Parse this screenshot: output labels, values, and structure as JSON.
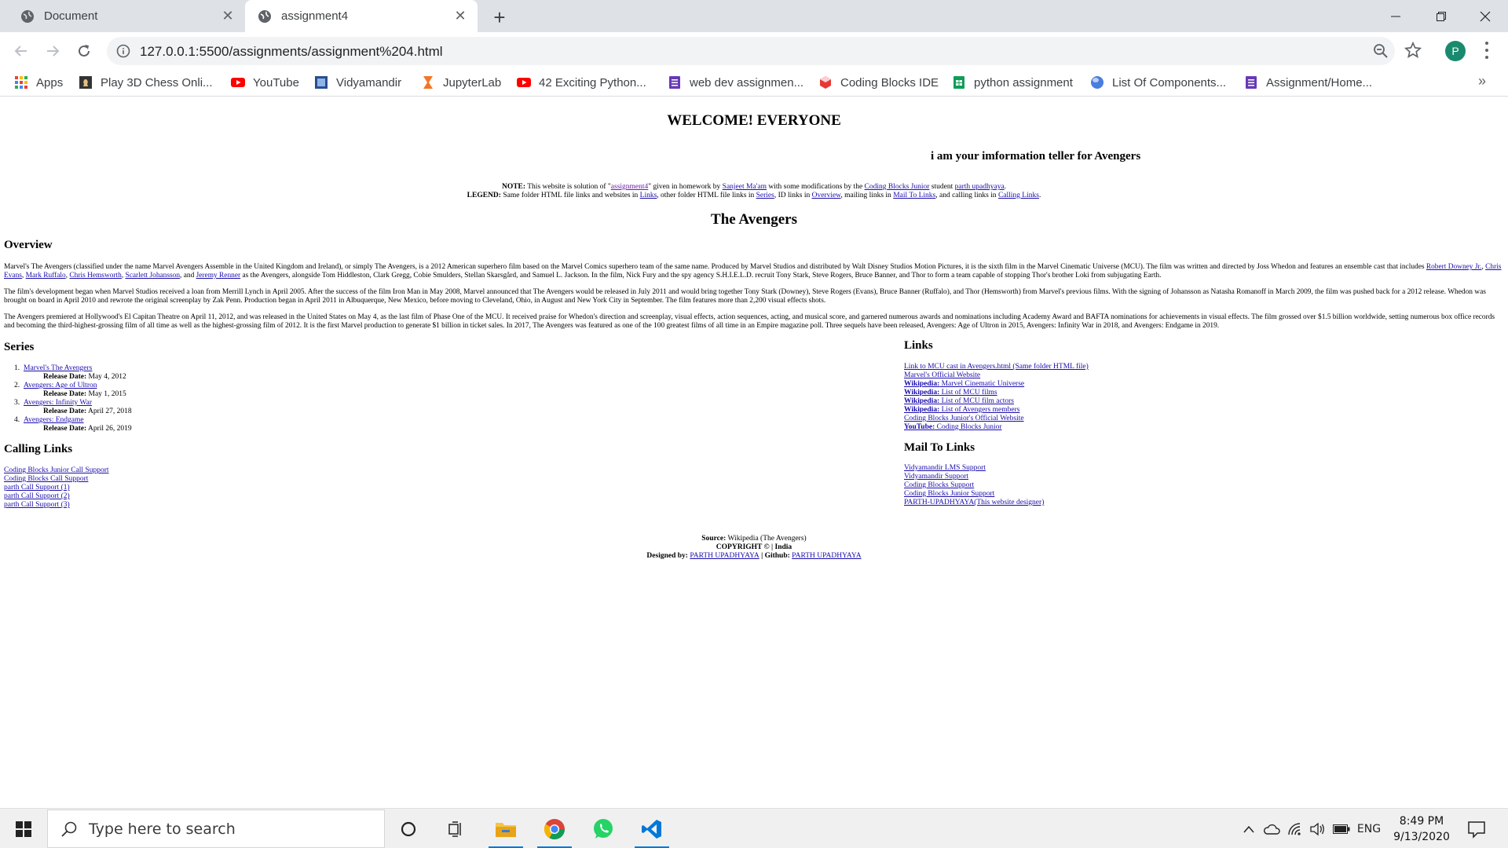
{
  "browser": {
    "tabs": [
      {
        "title": "Document",
        "active": false
      },
      {
        "title": "assignment4",
        "active": true
      }
    ],
    "url": "127.0.0.1:5500/assignments/assignment%204.html",
    "profile_initial": "P",
    "bookmarks": [
      {
        "label": "Apps",
        "icon": "apps-grid-icon"
      },
      {
        "label": "Play 3D Chess Onli...",
        "icon": "chess-icon"
      },
      {
        "label": "YouTube",
        "icon": "youtube-icon"
      },
      {
        "label": "Vidyamandir",
        "icon": "vidyamandir-icon"
      },
      {
        "label": "JupyterLab",
        "icon": "jupyter-icon"
      },
      {
        "label": "42 Exciting Python...",
        "icon": "youtube-icon"
      },
      {
        "label": "web dev assignmen...",
        "icon": "forms-icon"
      },
      {
        "label": "Coding Blocks IDE",
        "icon": "coding-blocks-icon"
      },
      {
        "label": "python assignment",
        "icon": "sheets-icon"
      },
      {
        "label": "List Of Components...",
        "icon": "globe-icon"
      },
      {
        "label": "Assignment/Home...",
        "icon": "forms-icon"
      }
    ],
    "bookmarks_more": "»"
  },
  "page": {
    "welcome": "WELCOME! EVERYONE",
    "teller": "i am your imformation teller for Avengers",
    "note": {
      "label": "NOTE:",
      "t1": " This website is solution of \"",
      "link1": "assignment4",
      "t2": "\" given in homework by ",
      "link2": "Sanjeet Ma'am",
      "t3": " with some modifications by the ",
      "link3": "Coding Blocks Junior",
      "t4": " student ",
      "link4": "parth upadhyaya",
      "t5": "."
    },
    "legend": {
      "label": "LEGEND:",
      "t1": " Same folder HTML file links and websites in ",
      "link1": "Links",
      "t2": ", other folder HTML file links in ",
      "link2": "Series",
      "t3": ", ID links in ",
      "link3": "Overview",
      "t4": ", mailing links in ",
      "link4": "Mail To Links",
      "t5": ", and calling links in ",
      "link5": "Calling Links",
      "t6": "."
    },
    "title": "The Avengers",
    "overview_heading": "Overview",
    "p1": {
      "t1": "Marvel's The Avengers (classified under the name Marvel Avengers Assemble in the United Kingdom and Ireland), or simply The Avengers, is a 2012 American superhero film based on the Marvel Comics superhero team of the same name. Produced by Marvel Studios and distributed by Walt Disney Studios Motion Pictures, it is the sixth film in the Marvel Cinematic Universe (MCU). The film was written and directed by Joss Whedon and features an ensemble cast that includes ",
      "a1": "Robert Downey Jr.",
      "s1": ", ",
      "a2": "Chris Evans",
      "s2": ", ",
      "a3": "Mark Ruffalo",
      "s3": ", ",
      "a4": "Chris Hemsworth",
      "s4": ", ",
      "a5": "Scarlett Johansson",
      "s5": ", and ",
      "a6": "Jeremy Renner",
      "t2": " as the Avengers, alongside Tom Hiddleston, Clark Gregg, Cobie Smulders, Stellan Skarsgård, and Samuel L. Jackson. In the film, Nick Fury and the spy agency S.H.I.E.L.D. recruit Tony Stark, Steve Rogers, Bruce Banner, and Thor to form a team capable of stopping Thor's brother Loki from subjugating Earth."
    },
    "p2": "The film's development began when Marvel Studios received a loan from Merrill Lynch in April 2005. After the success of the film Iron Man in May 2008, Marvel announced that The Avengers would be released in July 2011 and would bring together Tony Stark (Downey), Steve Rogers (Evans), Bruce Banner (Ruffalo), and Thor (Hemsworth) from Marvel's previous films. With the signing of Johansson as Natasha Romanoff in March 2009, the film was pushed back for a 2012 release. Whedon was brought on board in April 2010 and rewrote the original screenplay by Zak Penn. Production began in April 2011 in Albuquerque, New Mexico, before moving to Cleveland, Ohio, in August and New York City in September. The film features more than 2,200 visual effects shots.",
    "p3": "The Avengers premiered at Hollywood's El Capitan Theatre on April 11, 2012, and was released in the United States on May 4, as the last film of Phase One of the MCU. It received praise for Whedon's direction and screenplay, visual effects, action sequences, acting, and musical score, and garnered numerous awards and nominations including Academy Award and BAFTA nominations for achievements in visual effects. The film grossed over $1.5 billion worldwide, setting numerous box office records and becoming the third-highest-grossing film of all time as well as the highest-grossing film of 2012. It is the first Marvel production to generate $1 billion in ticket sales. In 2017, The Avengers was featured as one of the 100 greatest films of all time in an Empire magazine poll. Three sequels have been released, Avengers: Age of Ultron in 2015, Avengers: Infinity War in 2018, and Avengers: Endgame in 2019.",
    "series_heading": "Series",
    "release_label": "Release Date:",
    "series": [
      {
        "num": "1.",
        "title": "Marvel's The Avengers",
        "date": " May 4, 2012"
      },
      {
        "num": "2.",
        "title": "Avengers: Age of Ultron",
        "date": " May 1, 2015"
      },
      {
        "num": "3.",
        "title": "Avengers: Infinity War",
        "date": " April 27, 2018"
      },
      {
        "num": "4.",
        "title": "Avengers: Endgame",
        "date": " April 26, 2019"
      }
    ],
    "calling_heading": "Calling Links",
    "calling": [
      "Coding Blocks Junior Call Support",
      "Coding Blocks Call Support",
      "parth Call Support (1)",
      "parth Call Support (2)",
      "parth Call Support (3)"
    ],
    "links_heading": "Links",
    "links": [
      {
        "bold": "",
        "text": "Link to MCU cast in Avengers.html (Same folder HTML file)"
      },
      {
        "bold": "",
        "text": "Marvel's Official Website"
      },
      {
        "bold": "Wikipedia:",
        "text": " Marvel Cinematic Universe"
      },
      {
        "bold": "Wikipedia:",
        "text": " List of MCU films"
      },
      {
        "bold": "Wikipedia:",
        "text": " List of MCU film actors"
      },
      {
        "bold": "Wikipedia:",
        "text": " List of Avengers members"
      },
      {
        "bold": "",
        "text": "Coding Blocks Junior's Official Website"
      },
      {
        "bold": "YouTube:",
        "text": " Coding Blocks Junior"
      }
    ],
    "mail_heading": "Mail To Links",
    "mail": [
      "Vidyamandir LMS Support",
      "Vidyamandir Support",
      "Coding Blocks Support",
      "Coding Blocks Junior Support",
      "PARTH-UPADHYAYA(This website designer)"
    ],
    "footer": {
      "source_label": "Source:",
      "source_text": " Wikipedia (The Avengers)",
      "copyright": "COPYRIGHT © | India",
      "designed_label": "Designed by:",
      "designer_link": "PARTH UPADHYAYA",
      "github_label": " | Github:",
      "github_link": "PARTH UPADHYAYA"
    }
  },
  "taskbar": {
    "search_placeholder": "Type here to search",
    "apps": [
      "cortana-icon",
      "task-view-icon",
      "file-explorer-icon",
      "chrome-icon",
      "whatsapp-icon",
      "vscode-icon"
    ],
    "language": "ENG",
    "time": "8:49 PM",
    "date": "9/13/2020"
  },
  "colors": {
    "link": "#1a0dab",
    "tabstrip": "#dee1e6",
    "accent": "#0078d7"
  }
}
